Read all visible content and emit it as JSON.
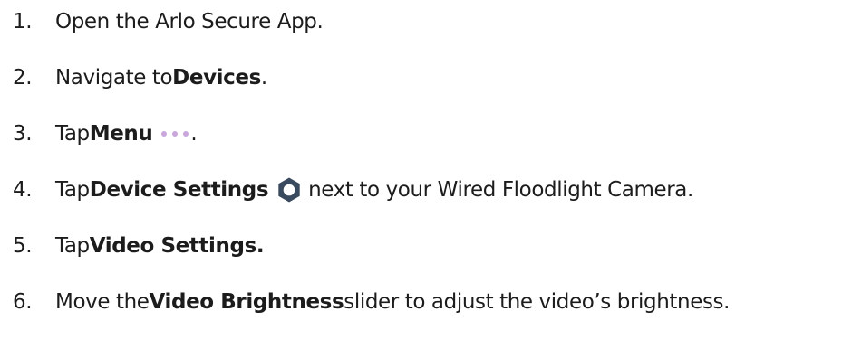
{
  "accent_color": "#c9a6dc",
  "gear_color": "#3a4a5e",
  "steps": [
    {
      "number": "1.",
      "text": "Open the Arlo Secure App."
    },
    {
      "number": "2.",
      "pre": "Navigate to ",
      "bold": "Devices",
      "post": "."
    },
    {
      "number": "3.",
      "pre": "Tap ",
      "bold": "Menu",
      "icon": "more-dots-icon",
      "post": "."
    },
    {
      "number": "4.",
      "pre": "Tap ",
      "bold": "Device Settings",
      "icon": "gear-icon",
      "post": "next to your Wired Floodlight Camera."
    },
    {
      "number": "5.",
      "pre": "Tap ",
      "bold": "Video Settings."
    },
    {
      "number": "6.",
      "pre": "Move the ",
      "bold": "Video Brightness",
      "post": " slider to adjust the video’s brightness."
    }
  ]
}
